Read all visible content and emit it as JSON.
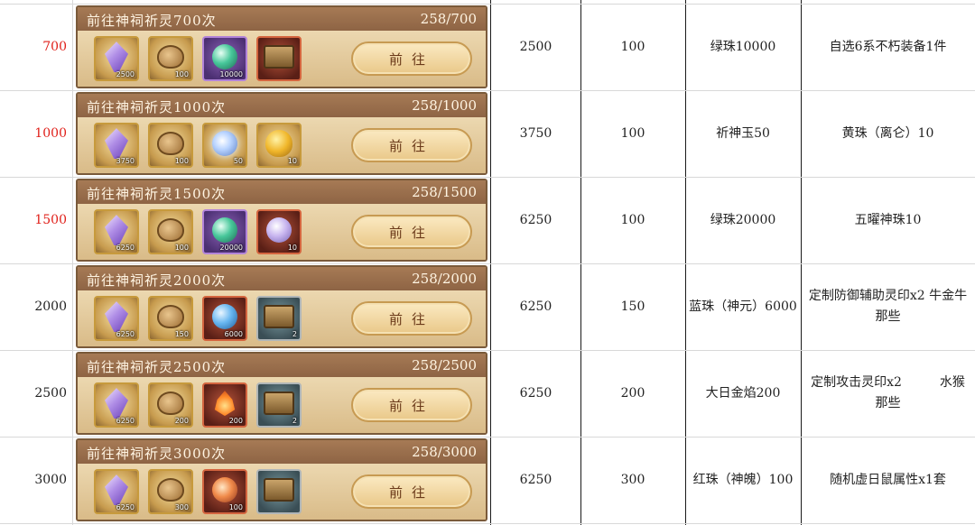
{
  "go_label": "前往",
  "rows": [
    {
      "threshold": "700",
      "threshold_red": true,
      "title": "前往神祠祈灵700次",
      "progress": "258/700",
      "items": [
        {
          "icon": "gem-icon",
          "style": "gold",
          "glyph": "gem",
          "count": "2500"
        },
        {
          "icon": "pig-icon",
          "style": "gold",
          "glyph": "pig",
          "count": "100"
        },
        {
          "icon": "green-orb-icon",
          "style": "purple",
          "glyph": "orb green",
          "count": "10000"
        },
        {
          "icon": "chest-icon",
          "style": "red",
          "glyph": "chest",
          "count": ""
        }
      ],
      "cols": [
        "2500",
        "100",
        "绿珠10000",
        "自选6系不朽装备1件"
      ]
    },
    {
      "threshold": "1000",
      "threshold_red": true,
      "title": "前往神祠祈灵1000次",
      "progress": "258/1000",
      "items": [
        {
          "icon": "gem-icon",
          "style": "gold",
          "glyph": "gem",
          "count": "3750"
        },
        {
          "icon": "pig-icon",
          "style": "gold",
          "glyph": "pig",
          "count": "100"
        },
        {
          "icon": "white-orb-icon",
          "style": "gold",
          "glyph": "orb white",
          "count": "50"
        },
        {
          "icon": "treasure-bag-icon",
          "style": "gold",
          "glyph": "bag",
          "count": "10"
        }
      ],
      "cols": [
        "3750",
        "100",
        "祈神玉50",
        "黄珠（离仑）10"
      ]
    },
    {
      "threshold": "1500",
      "threshold_red": true,
      "title": "前往神祠祈灵1500次",
      "progress": "258/1500",
      "items": [
        {
          "icon": "gem-icon",
          "style": "gold",
          "glyph": "gem",
          "count": "6250"
        },
        {
          "icon": "pig-icon",
          "style": "gold",
          "glyph": "pig",
          "count": "100"
        },
        {
          "icon": "green-orb-icon",
          "style": "purple",
          "glyph": "orb green",
          "count": "20000"
        },
        {
          "icon": "pearl-orb-icon",
          "style": "red",
          "glyph": "orb pearl",
          "count": "10"
        }
      ],
      "cols": [
        "6250",
        "100",
        "绿珠20000",
        "五曜神珠10"
      ]
    },
    {
      "threshold": "2000",
      "threshold_red": false,
      "title": "前往神祠祈灵2000次",
      "progress": "258/2000",
      "items": [
        {
          "icon": "gem-icon",
          "style": "gold",
          "glyph": "gem",
          "count": "6250"
        },
        {
          "icon": "pig-icon",
          "style": "gold",
          "glyph": "pig",
          "count": "150"
        },
        {
          "icon": "blue-orb-icon",
          "style": "red",
          "glyph": "orb sky",
          "count": "6000"
        },
        {
          "icon": "chest-icon",
          "style": "teal",
          "glyph": "chest",
          "count": "2"
        }
      ],
      "cols": [
        "6250",
        "150",
        "蓝珠（神元）6000",
        "定制防御辅助灵印x2 牛金牛那些"
      ]
    },
    {
      "threshold": "2500",
      "threshold_red": false,
      "title": "前往神祠祈灵2500次",
      "progress": "258/2500",
      "items": [
        {
          "icon": "gem-icon",
          "style": "gold",
          "glyph": "gem",
          "count": "6250"
        },
        {
          "icon": "pig-icon",
          "style": "gold",
          "glyph": "pig",
          "count": "200"
        },
        {
          "icon": "flame-icon",
          "style": "red",
          "glyph": "orb fire",
          "count": "200"
        },
        {
          "icon": "chest-icon",
          "style": "teal",
          "glyph": "chest",
          "count": "2"
        }
      ],
      "cols": [
        "6250",
        "200",
        "大日金焰200",
        "定制攻击灵印x2　　　水猴那些"
      ]
    },
    {
      "threshold": "3000",
      "threshold_red": false,
      "title": "前往神祠祈灵3000次",
      "progress": "258/3000",
      "items": [
        {
          "icon": "gem-icon",
          "style": "gold",
          "glyph": "gem",
          "count": "6250"
        },
        {
          "icon": "pig-icon",
          "style": "gold",
          "glyph": "pig",
          "count": "300"
        },
        {
          "icon": "ember-orb-icon",
          "style": "red",
          "glyph": "orb ember",
          "count": "100"
        },
        {
          "icon": "chest-icon",
          "style": "teal",
          "glyph": "chest",
          "count": ""
        }
      ],
      "cols": [
        "6250",
        "300",
        "红珠（神魄）100",
        "随机虚日鼠属性x1套"
      ]
    }
  ]
}
